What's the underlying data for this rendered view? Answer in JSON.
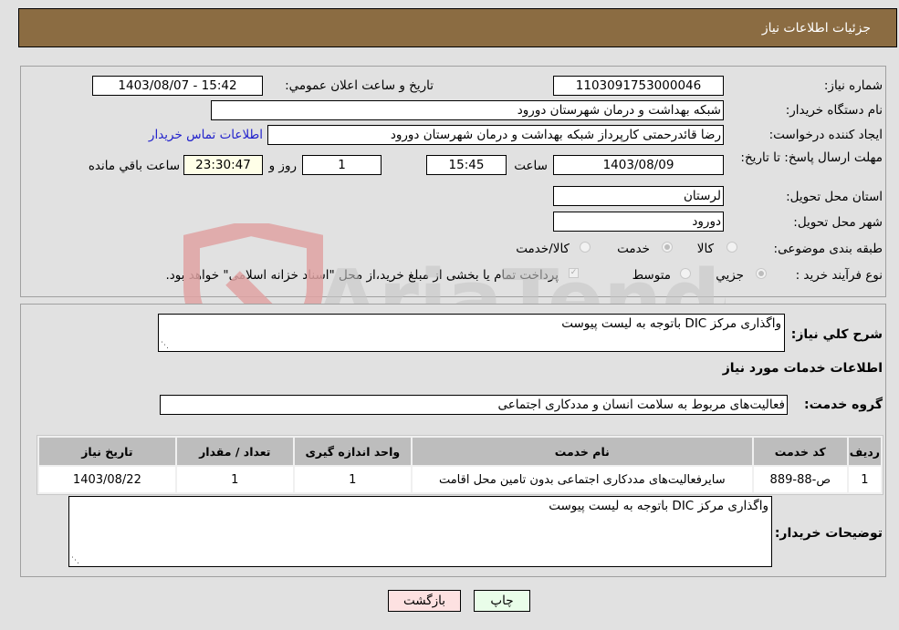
{
  "header": {
    "title": "جزئیات اطلاعات نیاز"
  },
  "fields": {
    "need_number_label": "شماره نیاز:",
    "need_number": "1103091753000046",
    "announce_label": "تاریخ و ساعت اعلان عمومي:",
    "announce_value": "1403/08/07 - 15:42",
    "buyer_org_label": "نام دستگاه خریدار:",
    "buyer_org": "شبکه بهداشت و درمان شهرستان دورود",
    "creator_label": "ایجاد کننده درخواست:",
    "creator": "رضا قائدرحمتی کارپرداز شبکه بهداشت و درمان شهرستان دورود",
    "contact_link": "اطلاعات تماس خریدار",
    "deadline_label": "مهلت ارسال پاسخ: تا تاریخ:",
    "deadline_date": "1403/08/09",
    "time_label": "ساعت",
    "deadline_time": "15:45",
    "days_value": "1",
    "days_label": "روز و",
    "remaining_time": "23:30:47",
    "remaining_label": "ساعت باقي مانده",
    "province_label": "استان محل تحویل:",
    "province": "لرستان",
    "city_label": "شهر محل تحویل:",
    "city": "دورود",
    "category_label": "طبقه بندی موضوعی:",
    "category_options": [
      {
        "label": "کالا",
        "selected": false
      },
      {
        "label": "خدمت",
        "selected": true
      },
      {
        "label": "کالا/خدمت",
        "selected": false
      }
    ],
    "process_label": "نوع فرآیند خرید :",
    "process_options": [
      {
        "label": "جزيي",
        "selected": true
      },
      {
        "label": "متوسط",
        "selected": false
      }
    ],
    "treasury_checked": true,
    "treasury_text": "پرداخت تمام یا بخشی از مبلغ خرید،از محل \"اسناد خزانه اسلامی\" خواهد بود."
  },
  "details": {
    "description_label": "شرح کلي نیاز:",
    "description": "واگذاری مرکز DIC باتوجه به لیست پیوست",
    "services_heading": "اطلاعات خدمات مورد نیاز",
    "service_group_label": "گروه خدمت:",
    "service_group": "فعالیت‌های مربوط به سلامت انسان و مددکاری اجتماعی",
    "table": {
      "headers": [
        "ردیف",
        "کد خدمت",
        "نام خدمت",
        "واحد اندازه گیری",
        "تعداد / مقدار",
        "تاریخ نیاز"
      ],
      "rows": [
        [
          "1",
          "ص-88-889",
          "سایرفعالیت‌های مددکاری اجتماعی بدون تامین محل اقامت",
          "1",
          "1",
          "1403/08/22"
        ]
      ]
    },
    "buyer_notes_label": "توضیحات خریدار:",
    "buyer_notes": "واگذاری مرکز DIC باتوجه به لیست پیوست"
  },
  "buttons": {
    "print": "چاپ",
    "back": "بازگشت"
  },
  "watermark": {
    "text": "AriaTender.neT"
  }
}
